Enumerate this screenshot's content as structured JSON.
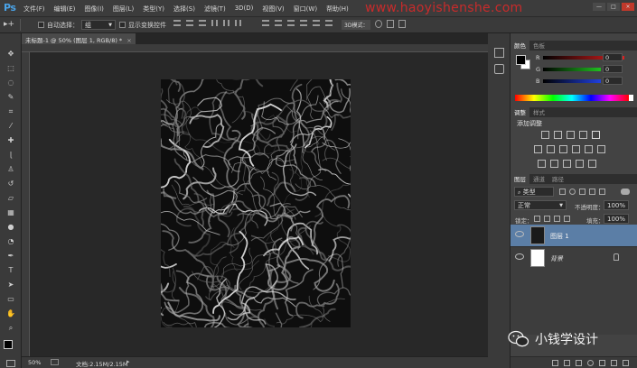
{
  "app": {
    "logo": "Ps"
  },
  "menu": [
    "文件(F)",
    "编辑(E)",
    "图像(I)",
    "图层(L)",
    "类型(Y)",
    "选择(S)",
    "滤镜(T)",
    "3D(D)",
    "视图(V)",
    "窗口(W)",
    "帮助(H)"
  ],
  "watermark": "www.haoyishenshe.com",
  "window_controls": [
    "—",
    "□",
    "×"
  ],
  "options": {
    "auto_select_label": "自动选择：",
    "auto_select_value": "组",
    "show_transform_label": "显示变换控件",
    "mode_3d": "3D模式："
  },
  "document": {
    "tab_title": "未标题-1 @ 50% (图层 1, RGB/8) *",
    "zoom": "50%",
    "doc_info": "文档:2.15M/2.15M"
  },
  "color_panel": {
    "tabs": [
      "颜色",
      "色板"
    ],
    "channels": [
      {
        "label": "R",
        "value": "0",
        "color": "#e02020"
      },
      {
        "label": "G",
        "value": "0",
        "color": "#20c020"
      },
      {
        "label": "B",
        "value": "0",
        "color": "#2040e0"
      }
    ]
  },
  "adjustments_panel": {
    "tabs": [
      "调整",
      "样式"
    ],
    "title": "添加调整"
  },
  "layers_panel": {
    "tabs": [
      "图层",
      "通道",
      "路径"
    ],
    "filter_kind": "类型",
    "blend_mode": "正常",
    "opacity_label": "不透明度：",
    "opacity_value": "100%",
    "lock_label": "锁定：",
    "fill_label": "填充：",
    "fill_value": "100%",
    "layers": [
      {
        "name": "图层 1",
        "selected": true
      },
      {
        "name": "背景",
        "selected": false,
        "locked": true
      }
    ]
  },
  "brand_overlay": {
    "text": "小钱学设计"
  }
}
